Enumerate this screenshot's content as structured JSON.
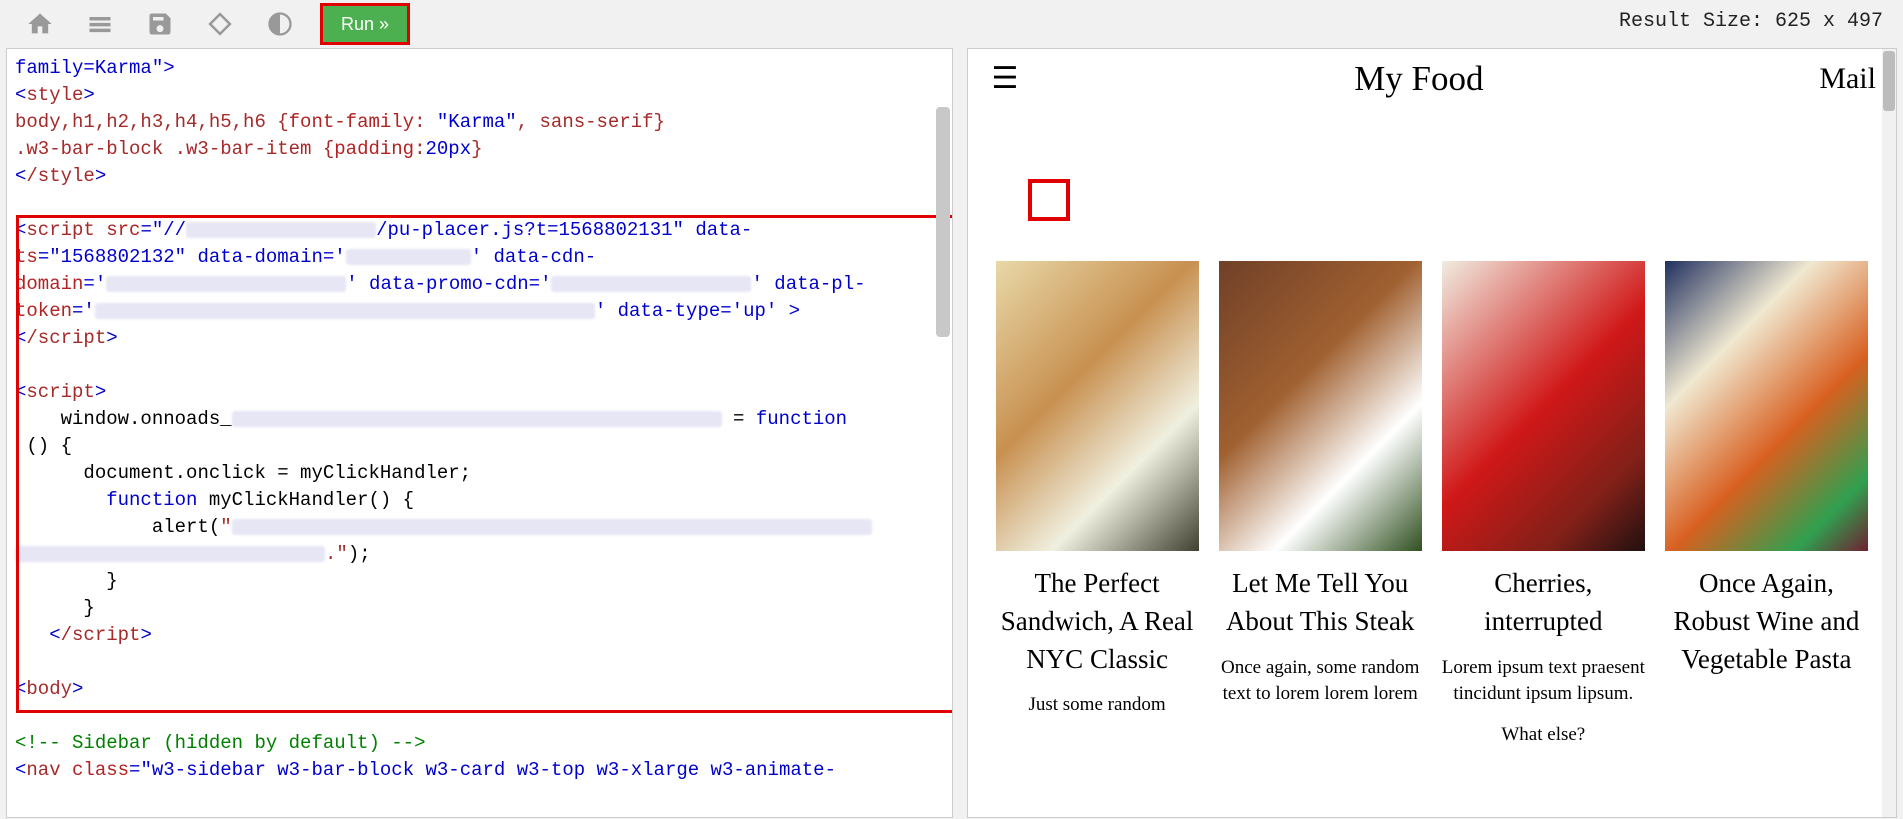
{
  "toolbar": {
    "run_label": "Run »"
  },
  "result_size": "Result Size: 625 x 497",
  "code": {
    "l1": "family=Karma\">",
    "l2a": "<",
    "l2b": "style",
    "l2c": ">",
    "l3a": "body,h1,h2,h3,h4,h5,h6 {",
    "l3b": "font-family",
    "l3c": ": ",
    "l3d": "\"Karma\"",
    "l3e": ", sans-serif}",
    "l4a": ".w3-bar-block .w3-bar-item {",
    "l4b": "padding",
    "l4c": ":",
    "l4d": "20px",
    "l4e": "}",
    "l5a": "<",
    "l5b": "/style",
    "l5c": ">",
    "l7a": "<",
    "l7b": "script",
    "l7c": " src",
    "l7d": "=\"",
    "l7e": "//",
    "l7f": "/pu-placer.js?t=1568802131",
    "l7g": "\" data-",
    "l8a": "ts",
    "l8b": "=\"",
    "l8c": "1568802132",
    "l8d": "\" data-domain",
    "l8e": "='",
    "l8f": "' data-cdn-",
    "l9a": "domain",
    "l9b": "='",
    "l9c": "' data-promo-cdn",
    "l9d": "='",
    "l9e": "' data-pl-",
    "l10a": "token",
    "l10b": "='",
    "l10c": "' data-type",
    "l10d": "='",
    "l10e": "up",
    "l10f": "' >",
    "l11a": "<",
    "l11b": "/script",
    "l11c": ">",
    "l13a": "<",
    "l13b": "script",
    "l13c": ">",
    "l14a": "    window.onnoads_",
    "l14b": " = ",
    "l14c": "function",
    "l15": " () {",
    "l16": "      document.onclick = myClickHandler;",
    "l17a": "        ",
    "l17b": "function",
    "l17c": " myClickHandler() {",
    "l18a": "            alert(",
    "l18b": "\"",
    "l19a": ".\"",
    "l19b": ");",
    "l20": "        }",
    "l21": "      }",
    "l22a": "   <",
    "l22b": "/script",
    "l22c": ">",
    "l24a": "<",
    "l24b": "body",
    "l24c": ">",
    "l26": "<!-- Sidebar (hidden by default) -->",
    "l27a": "<",
    "l27b": "nav",
    "l27c": " class",
    "l27d": "=\"",
    "l27e": "w3-sidebar w3-bar-block w3-card w3-top w3-xlarge w3-animate-"
  },
  "preview": {
    "title": "My Food",
    "mail": "Mail",
    "cards": [
      {
        "title": "The Perfect Sandwich, A Real NYC Classic",
        "text": "Just some random"
      },
      {
        "title": "Let Me Tell You About This Steak",
        "text": "Once again, some random text to lorem lorem lorem"
      },
      {
        "title": "Cherries, interrupted",
        "text": "Lorem ipsum text praesent tincidunt ipsum lipsum.",
        "text2": "What else?"
      },
      {
        "title": "Once Again, Robust Wine and Vegetable Pasta",
        "text": ""
      }
    ]
  }
}
